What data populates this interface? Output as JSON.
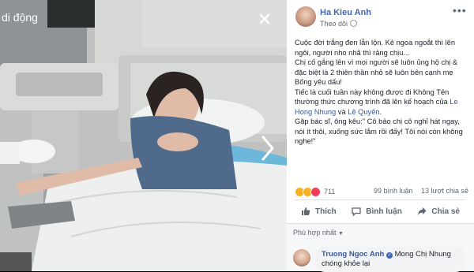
{
  "photo": {
    "caption": "di động"
  },
  "post": {
    "author": "Ha Kieu Anh",
    "follow_label": "Theo dõi",
    "paragraphs": [
      "Cuộc đời trắng đen lẫn lộn. Kẻ ngoa ngoắt thì lên ngôi, người nho nhã thì rảng chịu...",
      "Chị cố gắng lên vì mọi người sẽ luôn ủng hộ chị & đặc biệt là 2 thiên thần nhỏ sẽ luôn bên cạnh mẹ Bống yêu dấu!"
    ],
    "para3_before": "Tiếc là cuối tuần này không được đi Không Tên thường thức chương trình đã lên kế hoạch của ",
    "link1": "Le Hong Nhung",
    "para3_mid": " và ",
    "link2": "Lệ Quyên",
    "para3_after": ".",
    "paragraph4": "Gặp bác sĩ, ông kêu:\" Cô bảo chị cô nghỉ hát ngay, nói ít thôi, xuống sức lắm rồi đấy! Tôi nói còn không nghe!\"",
    "reaction_count": "711",
    "comments_count": "99 bình luận",
    "shares_count": "13 lượt chia sẻ",
    "actions": {
      "like": "Thích",
      "comment": "Bình luận",
      "share": "Chia sẻ"
    },
    "sort_label": "Phù hợp nhất"
  },
  "comment": {
    "name": "Truong Ngoc Anh",
    "text": "Mong Chị Nhung chóng khỏe lại"
  },
  "colors": {
    "link": "#385898",
    "author": "#4267b2",
    "love": "#f33e58",
    "care": "#f7b125"
  },
  "icons": [
    "close-icon",
    "chevron-right-icon",
    "more-icon",
    "globe-icon",
    "like-icon",
    "comment-icon",
    "share-icon",
    "verified-icon"
  ]
}
